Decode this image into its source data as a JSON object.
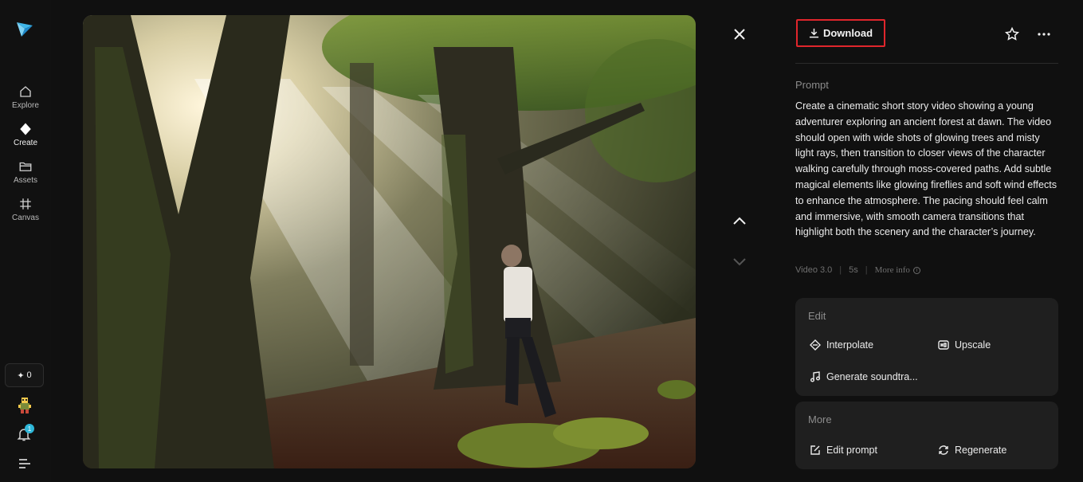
{
  "nav": {
    "items": [
      {
        "label": "Explore",
        "icon": "home-icon"
      },
      {
        "label": "Create",
        "icon": "diamond-icon"
      },
      {
        "label": "Assets",
        "icon": "folder-icon"
      },
      {
        "label": "Canvas",
        "icon": "canvas-icon"
      }
    ],
    "credits": "0",
    "notification_count": "1"
  },
  "panel": {
    "download_label": "Download",
    "prompt_label": "Prompt",
    "prompt_text": "Create a cinematic short story video showing a young adventurer exploring an ancient forest at dawn. The video should open with wide shots of glowing trees and misty light rays, then transition to closer views of the character walking carefully through moss-covered paths. Add subtle magical elements like glowing fireflies and soft wind effects to enhance the atmosphere. The pacing should feel calm and immersive, with smooth camera transitions that highlight both the scenery and the character’s journey.",
    "meta": {
      "model": "Video 3.0",
      "duration": "5s",
      "more_info": "More info"
    },
    "edit_card": {
      "title": "Edit",
      "actions": [
        "Interpolate",
        "Upscale",
        "Generate soundtra..."
      ]
    },
    "more_card": {
      "title": "More",
      "actions": [
        "Edit prompt",
        "Regenerate"
      ]
    }
  },
  "colors": {
    "accent_border": "#e0262c",
    "background": "#101010",
    "card": "#1f1f1f",
    "badge": "#2eb7d9"
  }
}
